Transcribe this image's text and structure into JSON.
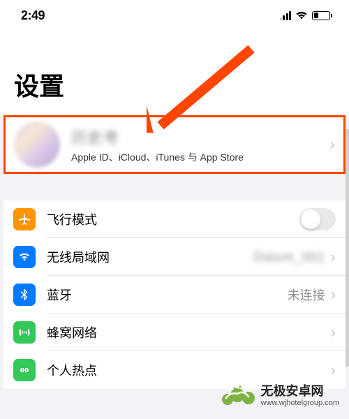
{
  "status": {
    "time": "2:49"
  },
  "page": {
    "title": "设置"
  },
  "apple_id": {
    "name": "历史考",
    "subtitle": "Apple ID、iCloud、iTunes 与 App Store"
  },
  "rows": {
    "airplane": {
      "label": "飞行模式"
    },
    "wifi": {
      "label": "无线局域网",
      "detail": "Datum_001"
    },
    "bluetooth": {
      "label": "蓝牙",
      "detail": "未连接"
    },
    "cellular": {
      "label": "蜂窝网络"
    },
    "hotspot": {
      "label": "个人热点"
    }
  },
  "watermark": {
    "name": "无极安卓网",
    "url": "www.wjhotelgroup.com"
  }
}
